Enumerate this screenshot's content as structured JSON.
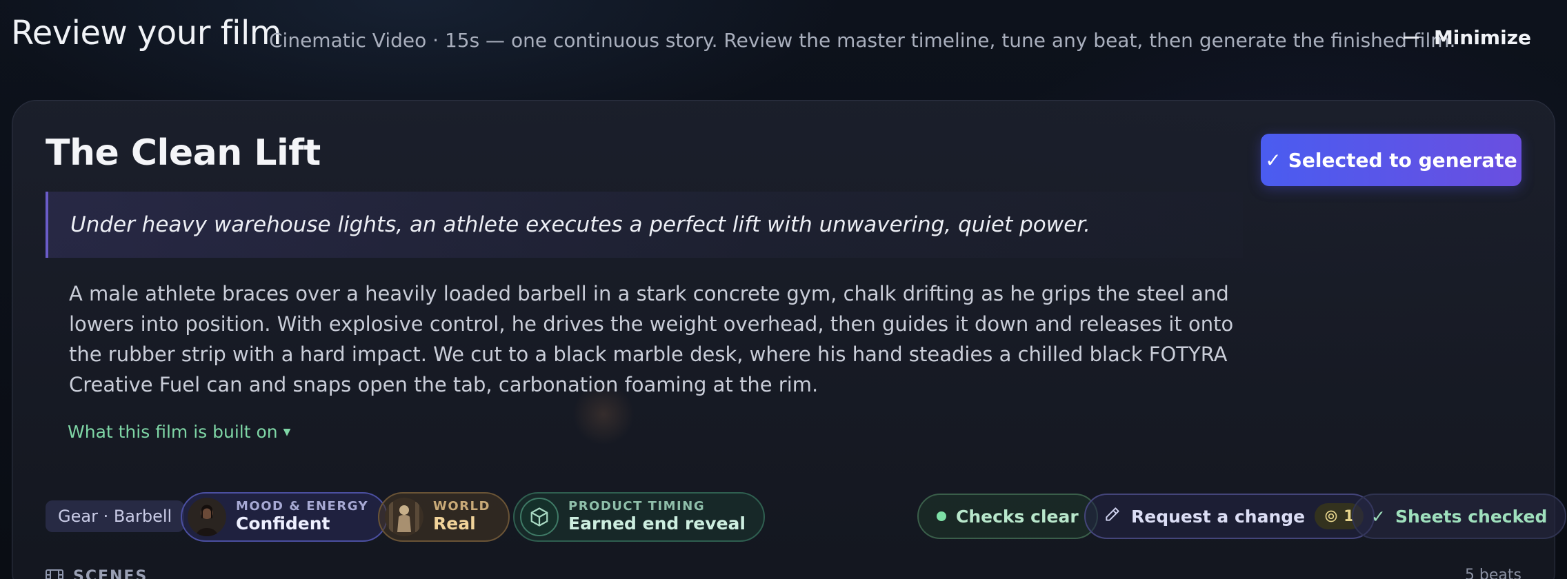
{
  "header": {
    "title": "Review your film",
    "subtitle": "Cinematic Video · 15s — one continuous story. Review the master timeline, tune any beat, then generate the finished film.",
    "minimize_label": "Minimize"
  },
  "film": {
    "title": "The Clean Lift",
    "generate_label": "Selected to generate",
    "logline": "Under heavy warehouse lights, an athlete executes a perfect lift with unwavering, quiet power.",
    "synopsis": "A male athlete braces over a heavily loaded barbell in a stark concrete gym, chalk drifting as he grips the steel and lowers into position. With explosive control, he drives the weight overhead, then guides it down and releases it onto the rubber strip with a hard impact. We cut to a black marble desk, where his hand steadies a chilled black FOTYRA Creative Fuel can and snaps open the tab, carbonation foaming at the rim.",
    "built_on_label": "What this film is built on"
  },
  "chips": {
    "gear": "Gear · Barbell",
    "mood": {
      "label": "MOOD & ENERGY",
      "value": "Confident"
    },
    "world": {
      "label": "WORLD",
      "value": "Real"
    },
    "timing": {
      "label": "PRODUCT TIMING",
      "value": "Earned end reveal"
    }
  },
  "status": {
    "checks_label": "Checks clear",
    "request_label": "Request a change",
    "request_count": "1",
    "sheets_label": "Sheets checked"
  },
  "scenes": {
    "label": "SCENES",
    "beats": "5 beats"
  },
  "colors": {
    "accent_start": "#4a5cf0",
    "accent_end": "#6a4fe0",
    "green": "#7fd6a6",
    "background": "#0b0e16"
  }
}
